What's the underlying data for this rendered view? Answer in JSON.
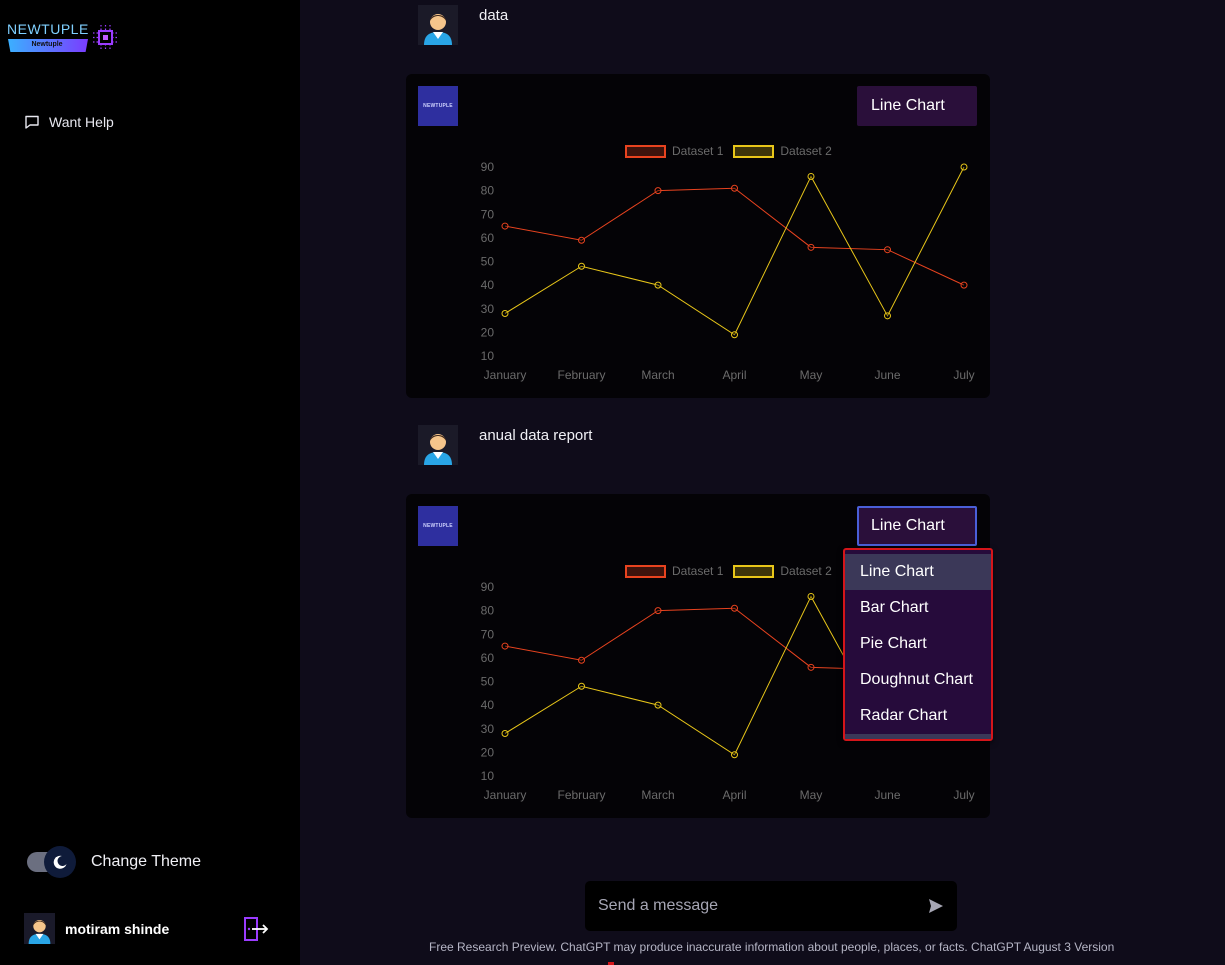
{
  "sidebar": {
    "logo_text": "NEWTUPLE",
    "logo_sub": "Newtuple",
    "help_label": "Want Help",
    "theme_label": "Change Theme",
    "user_name": "motiram shinde"
  },
  "messages": [
    {
      "role": "user",
      "text": "data"
    },
    {
      "role": "bot",
      "bot_logo": "NEWTUPLE",
      "chart_select": "Line Chart"
    },
    {
      "role": "user",
      "text": "anual data report"
    },
    {
      "role": "bot",
      "bot_logo": "NEWTUPLE",
      "chart_select": "Line Chart"
    }
  ],
  "dropdown": {
    "options": [
      "Line Chart",
      "Bar Chart",
      "Pie Chart",
      "Doughnut Chart",
      "Radar Chart"
    ],
    "selected": "Line Chart"
  },
  "input": {
    "placeholder": "Send a message"
  },
  "footer": "Free Research Preview. ChatGPT may produce inaccurate information about people, places, or facts. ChatGPT August 3 Version",
  "colors": {
    "dataset1": "#e8431f",
    "dataset2": "#e8c619",
    "select_bg": "#2a0f3a",
    "dropdown_border": "#d4151a"
  },
  "chart_data": [
    {
      "type": "line",
      "categories": [
        "January",
        "February",
        "March",
        "April",
        "May",
        "June",
        "July"
      ],
      "series": [
        {
          "name": "Dataset 1",
          "values": [
            65,
            59,
            80,
            81,
            56,
            55,
            40
          ]
        },
        {
          "name": "Dataset 2",
          "values": [
            28,
            48,
            40,
            19,
            86,
            27,
            90
          ]
        }
      ],
      "yticks": [
        10,
        20,
        30,
        40,
        50,
        60,
        70,
        80,
        90
      ],
      "ylim": [
        10,
        90
      ],
      "legend": "top-center",
      "grid": false
    },
    {
      "type": "line",
      "categories": [
        "January",
        "February",
        "March",
        "April",
        "May",
        "June",
        "July"
      ],
      "series": [
        {
          "name": "Dataset 1",
          "values": [
            65,
            59,
            80,
            81,
            56,
            55,
            40
          ]
        },
        {
          "name": "Dataset 2",
          "values": [
            28,
            48,
            40,
            19,
            86,
            27,
            90
          ]
        }
      ],
      "yticks": [
        10,
        20,
        30,
        40,
        50,
        60,
        70,
        80,
        90
      ],
      "ylim": [
        10,
        90
      ],
      "legend": "top-center",
      "grid": false
    }
  ]
}
